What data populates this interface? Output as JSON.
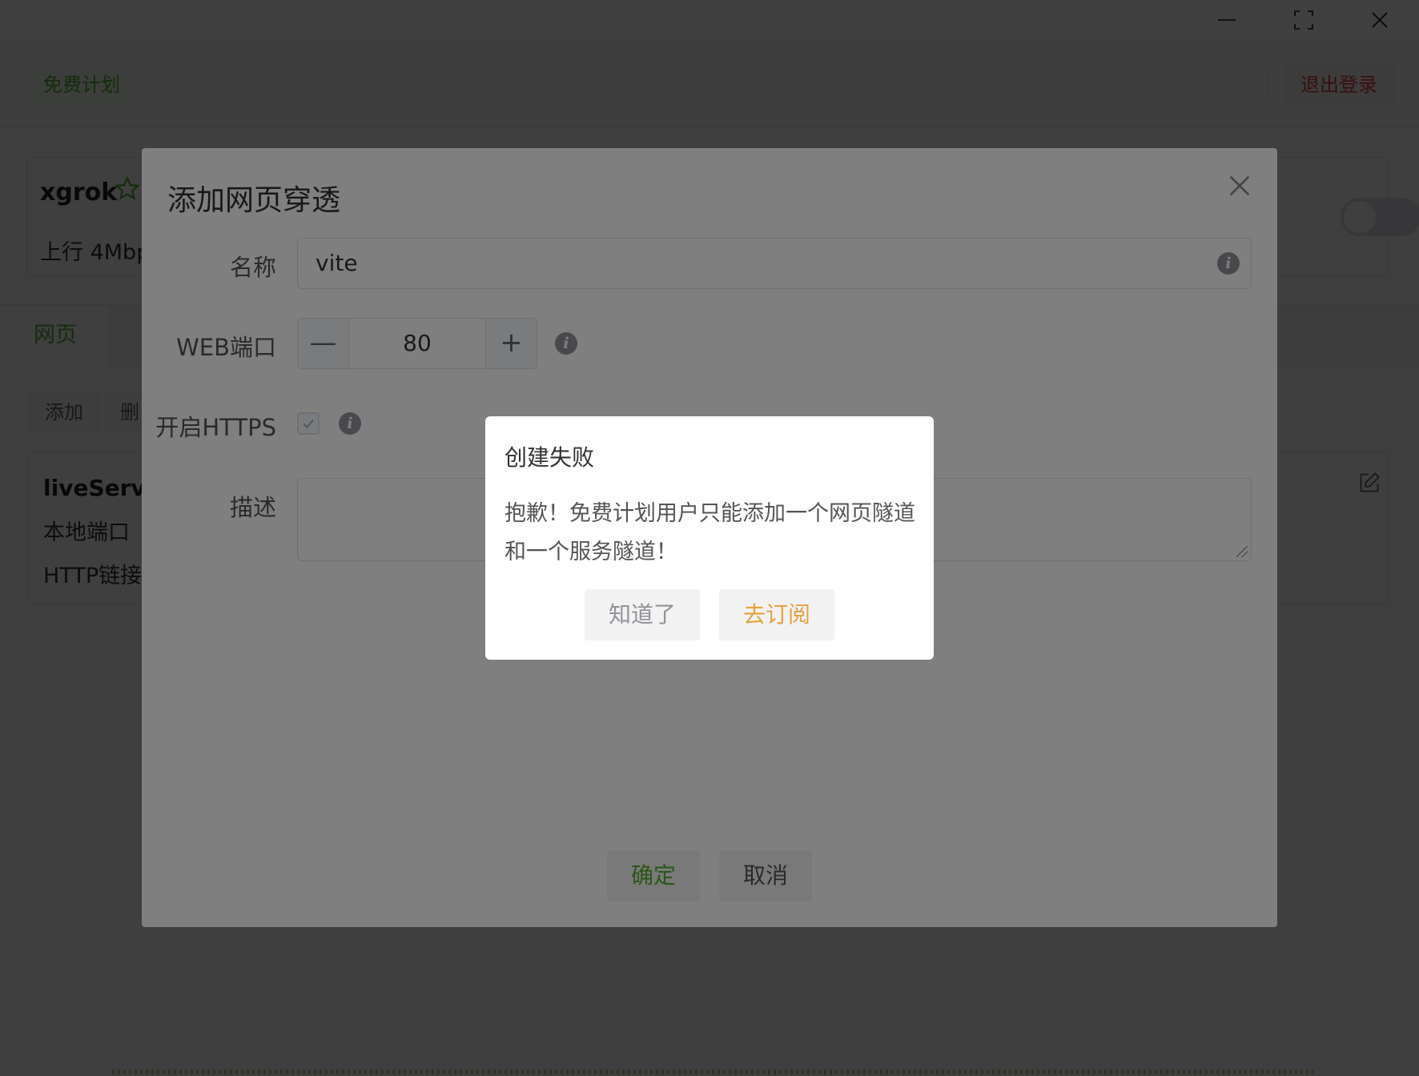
{
  "header": {
    "plan_label": "免费计划",
    "logout_label": "退出登录"
  },
  "server": {
    "name": "xgrok",
    "speed": "上行 4Mbp"
  },
  "tabs": [
    {
      "label": "网页"
    }
  ],
  "toolbar": {
    "add_label": "添加",
    "delete_label": "删"
  },
  "item": {
    "title": "liveServer",
    "local_port_label": "本地端口",
    "http_link_label": "HTTP链接"
  },
  "dialog": {
    "title": "添加网页穿透",
    "name_label": "名称",
    "name_value": "vite",
    "port_label": "WEB端口",
    "port_value": "80",
    "port_dec": "—",
    "port_inc": "+",
    "https_label": "开启HTTPS",
    "https_checked": true,
    "desc_label": "描述",
    "confirm_label": "确定",
    "cancel_label": "取消"
  },
  "message_box": {
    "title": "创建失败",
    "message": "抱歉！免费计划用户只能添加一个网页隧道和一个服务隧道！",
    "ack_label": "知道了",
    "subscribe_label": "去订阅"
  },
  "colors": {
    "accent": "#52b12c",
    "danger": "#e53935",
    "warning": "#e6a23c"
  }
}
